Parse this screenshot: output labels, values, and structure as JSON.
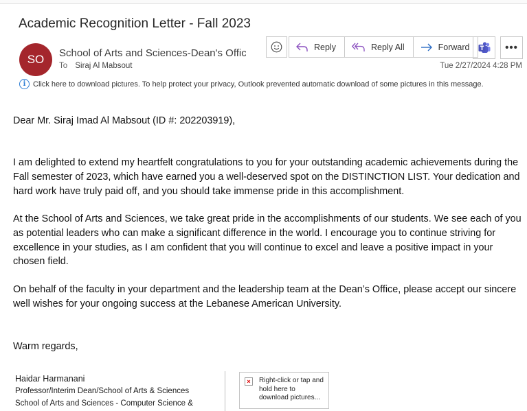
{
  "email": {
    "subject": "Academic Recognition Letter - Fall 2023",
    "avatar_initials": "SO",
    "avatar_color": "#a4262c",
    "sender": "School of Arts and Sciences-Dean's Office",
    "to_label": "To",
    "recipient": "Siraj Al Mabsout",
    "date": "Tue 2/27/2024 4:28 PM",
    "info_bar": "Click here to download pictures. To help protect your privacy, Outlook prevented automatic download of some pictures in this message."
  },
  "toolbar": {
    "emoji_icon": "smiley-icon",
    "reply_label": "Reply",
    "reply_all_label": "Reply All",
    "forward_label": "Forward",
    "teams_icon": "teams-icon",
    "more_label": "•••"
  },
  "body": {
    "greeting": "Dear Mr. Siraj Imad Al Mabsout (ID #: 202203919),",
    "paragraph1": "I am delighted to extend my heartfelt congratulations to you for your outstanding academic achievements during the Fall semester of 2023, which have earned you a well-deserved spot on the DISTINCTION LIST. Your dedication and hard work have truly paid off, and you should take immense pride in this accomplishment.",
    "paragraph2": "At the School of Arts and Sciences, we take great pride in the accomplishments of our students. We see each of you as potential leaders who can make a significant difference in the world. I encourage you to continue striving for excellence in your studies, as I am confident that you will continue to excel and leave a positive impact in your chosen field.",
    "paragraph3": "On behalf of the faculty in your department and the leadership team at the Dean’s Office, please accept our sincere well wishes for your ongoing success at the Lebanese American University.",
    "closing": "Warm regards,"
  },
  "signature": {
    "name": "Haidar Harmanani",
    "title": "Professor/Interim Dean/School of Arts & Sciences",
    "department": "School of Arts and Sciences - Computer Science &",
    "image_placeholder": "Right-click or tap and hold here to download pictures..."
  }
}
